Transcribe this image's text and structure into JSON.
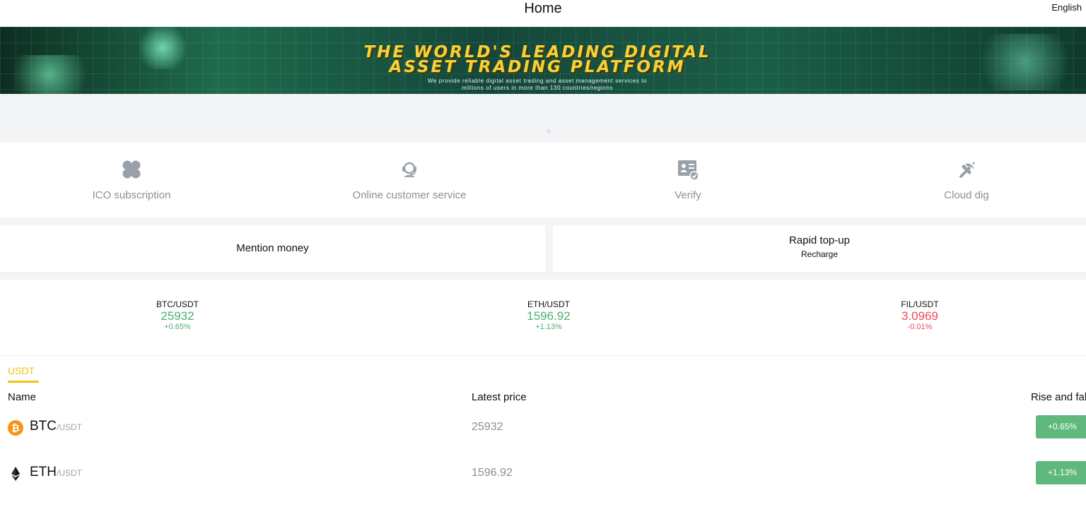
{
  "header": {
    "title": "Home",
    "language": "English"
  },
  "banner": {
    "headline_line1": "THE WORLD'S LEADING DIGITAL",
    "headline_line2": "ASSET TRADING PLATFORM",
    "subtitle_line1": "We provide reliable digital asset trading and asset management services to",
    "subtitle_line2": "millions of users in more than 130 countries/regions"
  },
  "nav": {
    "items": [
      {
        "label": "ICO subscription",
        "icon": "clover-icon"
      },
      {
        "label": "Online customer service",
        "icon": "headset-icon"
      },
      {
        "label": "Verify",
        "icon": "id-card-icon"
      },
      {
        "label": "Cloud dig",
        "icon": "pickaxe-icon"
      }
    ]
  },
  "actions": {
    "withdraw_label": "Mention money",
    "topup_label": "Rapid top-up",
    "topup_sub": "Recharge"
  },
  "tickers": [
    {
      "pair": "BTC/USDT",
      "price": "25932",
      "change": "+0.65%",
      "trend": "up"
    },
    {
      "pair": "ETH/USDT",
      "price": "1596.92",
      "change": "+1.13%",
      "trend": "up"
    },
    {
      "pair": "FIL/USDT",
      "price": "3.0969",
      "change": "-0.01%",
      "trend": "down"
    }
  ],
  "market": {
    "tab": "USDT",
    "columns": {
      "name": "Name",
      "price": "Latest price",
      "change": "Rise and fal"
    },
    "rows": [
      {
        "symbol": "BTC",
        "quote": "/USDT",
        "price": "25932",
        "change": "+0.65%",
        "icon": "bitcoin-icon"
      },
      {
        "symbol": "ETH",
        "quote": "/USDT",
        "price": "1596.92",
        "change": "+1.13%",
        "icon": "ethereum-icon"
      }
    ]
  },
  "colors": {
    "accent": "#f0c419",
    "up": "#4caf72",
    "down": "#e84a5f",
    "badge_up": "#5fb87c",
    "muted": "#8a8f99"
  }
}
